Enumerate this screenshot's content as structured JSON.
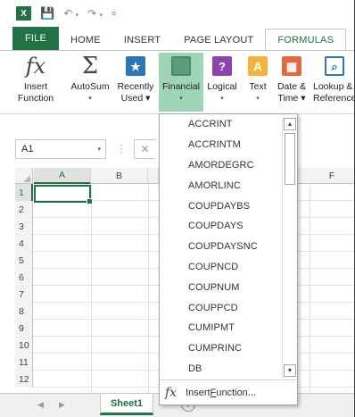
{
  "qat": {
    "logo": "X",
    "icons": [
      "save-icon",
      "undo-icon",
      "redo-icon",
      "customize-icon"
    ]
  },
  "tabs": [
    {
      "label": "FILE"
    },
    {
      "label": "HOME"
    },
    {
      "label": "INSERT"
    },
    {
      "label": "PAGE LAYOUT"
    },
    {
      "label": "FORMULAS"
    }
  ],
  "ribbon": {
    "insert_function": {
      "line1": "Insert",
      "line2": "Function"
    },
    "autosum": {
      "line1": "AutoSum",
      "line2": "▾"
    },
    "recently_used": {
      "line1": "Recently",
      "line2": "Used ▾"
    },
    "financial": {
      "line1": "Financial",
      "line2": "▾"
    },
    "logical": {
      "line1": "Logical",
      "line2": "▾"
    },
    "text": {
      "line1": "Text",
      "line2": "▾"
    },
    "date_time": {
      "line1": "Date &",
      "line2": "Time ▾"
    },
    "lookup": {
      "line1": "Lookup &",
      "line2": "Reference"
    }
  },
  "formula_bar": {
    "name_box": "A1",
    "name_box_arrow": "▾",
    "separator": "⋮",
    "cancel": "✕"
  },
  "grid": {
    "columns": [
      "A",
      "B",
      "F"
    ],
    "rows": [
      "1",
      "2",
      "3",
      "4",
      "5",
      "6",
      "7",
      "8",
      "9",
      "10",
      "11",
      "12"
    ],
    "selected_cell": "A1"
  },
  "dropdown": {
    "items": [
      "ACCRINT",
      "ACCRINTM",
      "AMORDEGRC",
      "AMORLINC",
      "COUPDAYBS",
      "COUPDAYS",
      "COUPDAYSNC",
      "COUPNCD",
      "COUPNUM",
      "COUPPCD",
      "CUMIPMT",
      "CUMPRINC",
      "DB"
    ],
    "insert_function_pre": "Insert ",
    "insert_function_ul": "F",
    "insert_function_post": "unction..."
  },
  "sheets": {
    "active": "Sheet1",
    "add": "+"
  },
  "colors": {
    "accent": "#217346",
    "financial_highlight": "#9fd5b7"
  }
}
